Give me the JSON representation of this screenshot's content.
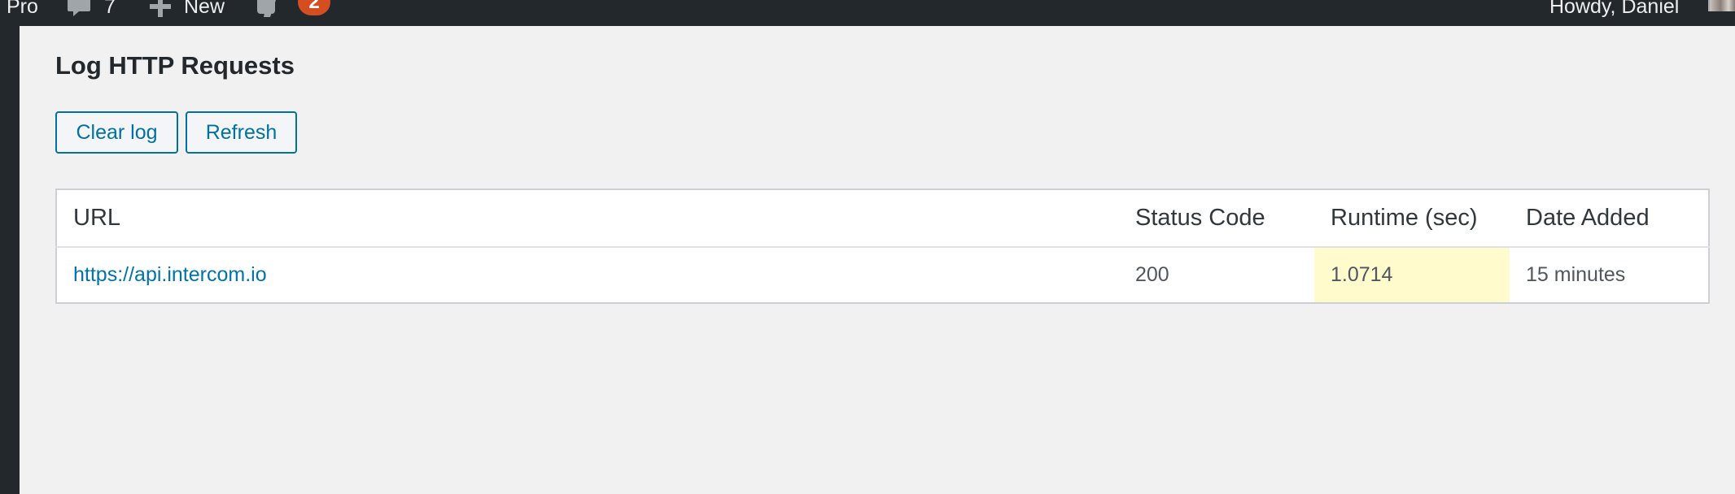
{
  "admin_bar": {
    "site_label": "Pro",
    "comments_count": "7",
    "new_label": "New",
    "updates_badge": "2",
    "greeting": "Howdy, Daniel"
  },
  "page": {
    "title": "Log HTTP Requests"
  },
  "actions": {
    "clear_label": "Clear log",
    "refresh_label": "Refresh"
  },
  "table": {
    "headers": {
      "url": "URL",
      "status": "Status Code",
      "runtime": "Runtime (sec)",
      "date": "Date Added"
    },
    "rows": [
      {
        "url": "https://api.intercom.io",
        "status": "200",
        "runtime": "1.0714",
        "date": "15 minutes"
      }
    ]
  },
  "colors": {
    "admin_bar_bg": "#23282d",
    "content_bg": "#f1f1f1",
    "accent_blue": "#0071a1",
    "badge_orange": "#d54e21",
    "runtime_highlight": "#fffbcc"
  }
}
